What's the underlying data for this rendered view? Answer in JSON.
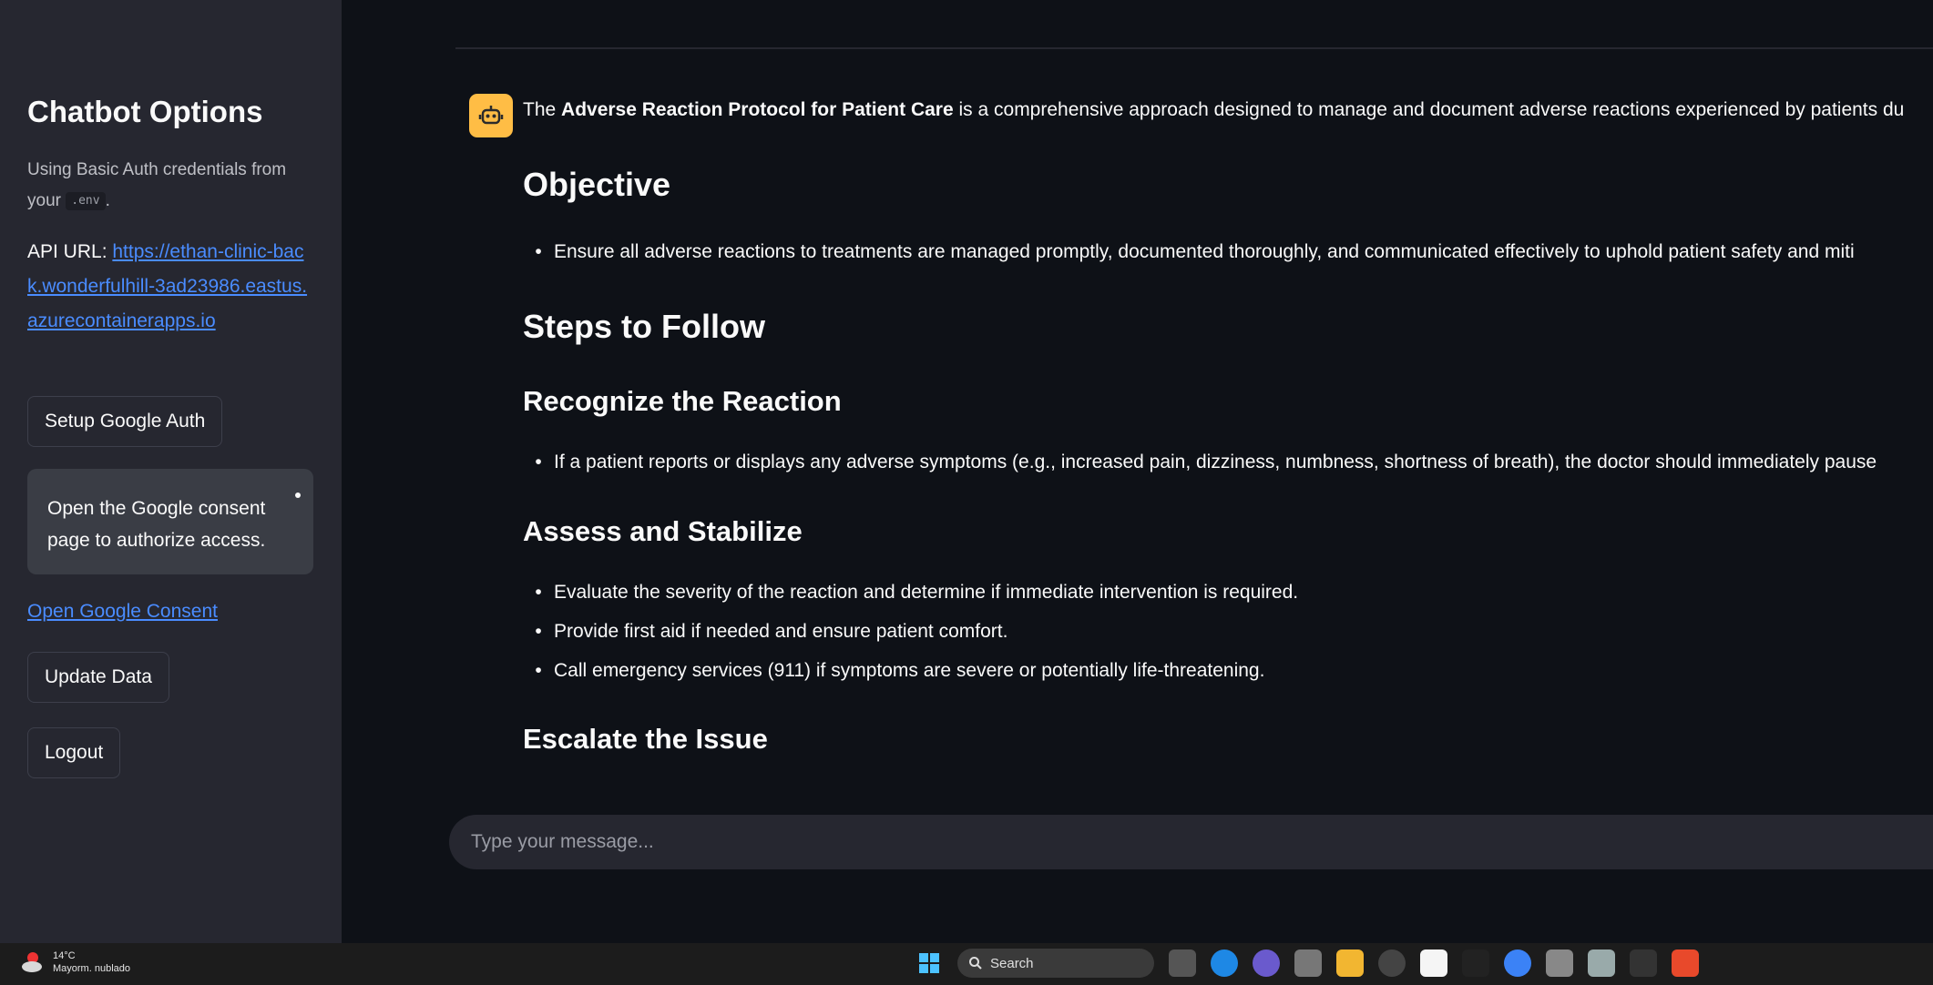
{
  "sidebar": {
    "title": "Chatbot Options",
    "note_prefix": "Using Basic Auth credentials from your",
    "note_code": ".env",
    "note_suffix": ".",
    "api_label": "API URL:",
    "api_url": "https://ethan-clinic-back.wonderfulhill-3ad23986.eastus.azurecontainerapps.io",
    "setup_google_auth": "Setup Google Auth",
    "info_text": "Open the Google consent page to authorize access.",
    "open_consent_link": "Open Google Consent",
    "update_data": "Update Data",
    "logout": "Logout"
  },
  "message": {
    "intro_prefix": "The",
    "intro_bold": "Adverse Reaction Protocol for Patient Care",
    "intro_suffix": "is a comprehensive approach designed to manage and document adverse reactions experienced by patients du",
    "objective_heading": "Objective",
    "objective_bullets": [
      "Ensure all adverse reactions to treatments are managed promptly, documented thoroughly, and communicated effectively to uphold patient safety and miti"
    ],
    "steps_heading": "Steps to Follow",
    "recognize_heading": "Recognize the Reaction",
    "recognize_bullets": [
      "If a patient reports or displays any adverse symptoms (e.g., increased pain, dizziness, numbness, shortness of breath), the doctor should immediately pause"
    ],
    "assess_heading": "Assess and Stabilize",
    "assess_bullets": [
      "Evaluate the severity of the reaction and determine if immediate intervention is required.",
      "Provide first aid if needed and ensure patient comfort.",
      "Call emergency services (911) if symptoms are severe or potentially life-threatening."
    ],
    "escalate_heading": "Escalate the Issue"
  },
  "chat_input": {
    "placeholder": "Type your message..."
  },
  "taskbar": {
    "weather_temp": "14°C",
    "weather_desc": "Mayorm. nublado",
    "search_label": "Search"
  },
  "colors": {
    "accent_link": "#4a8cff",
    "avatar": "#ffbd45",
    "sidebar_bg": "#262730",
    "main_bg": "#0e1117"
  }
}
